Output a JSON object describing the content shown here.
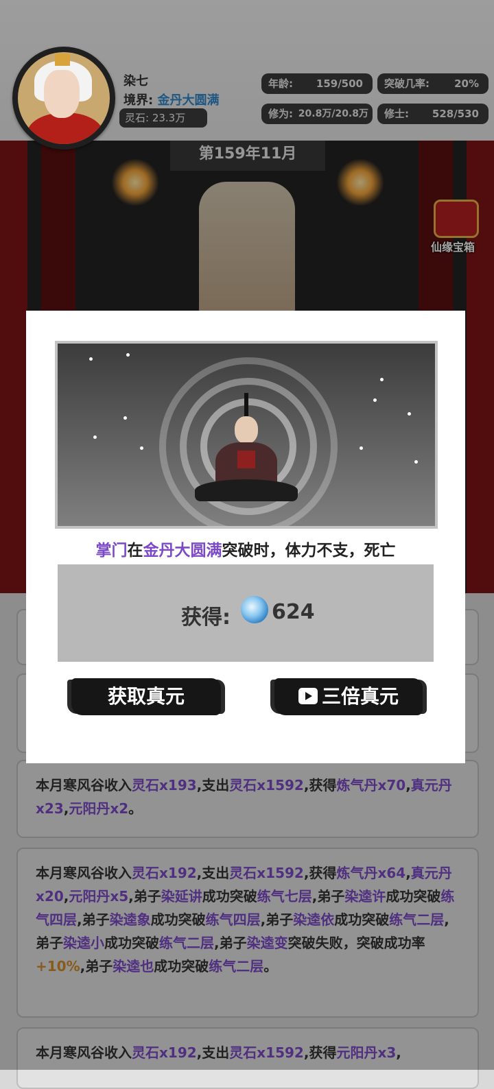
{
  "header": {
    "player_name": "染七",
    "realm_label": "境界:",
    "realm_value": "金丹大圆满",
    "spirit_stone": "灵石: 23.3万",
    "age_label": "年龄:",
    "age_value": "159/500",
    "breakthrough_label": "突破几率:",
    "breakthrough_value": "20%",
    "cultivation_label": "修为:",
    "cultivation_value": "20.8万/20.8万",
    "disciples_label": "修士:",
    "disciples_value": "528/530"
  },
  "scene": {
    "date": "第159年11月",
    "treasure_chest_label": "仙缘宝箱"
  },
  "modal": {
    "death_role": "掌门",
    "death_in": "在",
    "death_realm": "金丹大圆满",
    "death_rest": "突破时，体力不支，死亡",
    "reward_label": "获得:",
    "reward_value": "624",
    "btn_collect": "获取真元",
    "btn_triple": "三倍真元"
  },
  "logs": [
    {
      "parts": [
        "本月寒风谷收入",
        "灵石x193",
        ",支出",
        "灵石x1592",
        ",获得",
        "炼气丹x70",
        ",",
        "真元丹x23",
        ",",
        "元阳丹x2",
        "。"
      ]
    },
    {
      "parts": [
        "本月寒风谷收入",
        "灵石x192",
        ",支出",
        "灵石x1592",
        ",获得",
        "炼气丹x64",
        ",",
        "真元丹x20",
        ",",
        "元阳丹x5",
        ",弟子",
        "染延讲",
        "成功突破",
        "练气七层",
        ",弟子",
        "染逵许",
        "成功突破",
        "练气四层",
        ",弟子",
        "染逵象",
        "成功突破",
        "练气四层",
        ",弟子",
        "染逵依",
        "成功突破",
        "练气二层",
        ",弟子",
        "染逵小",
        "成功突破",
        "练气二层",
        ",弟子",
        "染逵变",
        "突破失败，突破成功率",
        "+10%",
        ",弟子",
        "染逵也",
        "成功突破",
        "练气二层",
        "。"
      ]
    },
    {
      "parts": [
        "本月寒风谷收入",
        "灵石x192",
        ",支出",
        "灵石x1592",
        ",获得",
        "元阳丹x3",
        ","
      ]
    }
  ]
}
